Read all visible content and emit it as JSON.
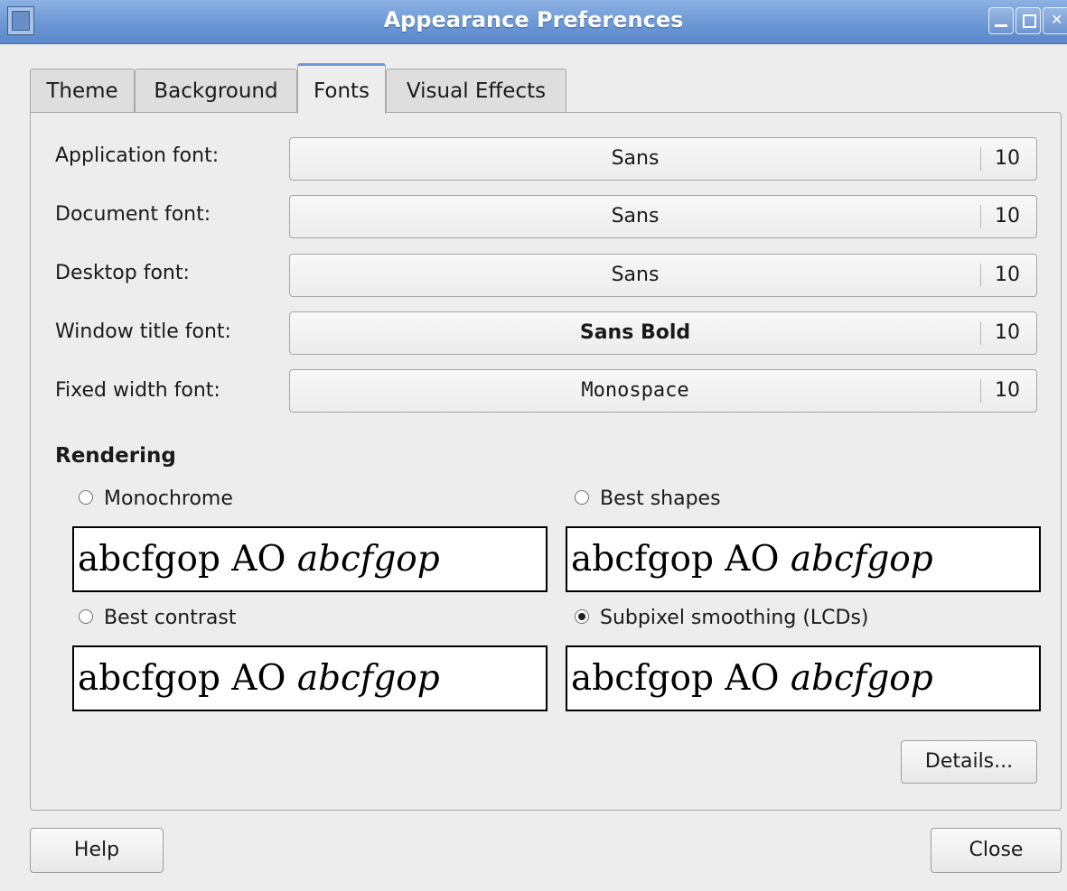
{
  "window": {
    "title": "Appearance Preferences"
  },
  "tabs": [
    {
      "label": "Theme",
      "active": false
    },
    {
      "label": "Background",
      "active": false
    },
    {
      "label": "Fonts",
      "active": true
    },
    {
      "label": "Visual Effects",
      "active": false
    }
  ],
  "fonts": [
    {
      "label": "Application font:",
      "font": "Sans",
      "size": "10"
    },
    {
      "label": "Document font:",
      "font": "Sans",
      "size": "10"
    },
    {
      "label": "Desktop font:",
      "font": "Sans",
      "size": "10"
    },
    {
      "label": "Window title font:",
      "font": "Sans Bold",
      "size": "10"
    },
    {
      "label": "Fixed width font:",
      "font": "Monospace",
      "size": "10"
    }
  ],
  "rendering": {
    "heading": "Rendering",
    "options": [
      {
        "label": "Monochrome",
        "checked": false,
        "sample_roman": "abcfgop AO ",
        "sample_italic": "abcfgop"
      },
      {
        "label": "Best shapes",
        "checked": false,
        "sample_roman": "abcfgop AO ",
        "sample_italic": "abcfgop"
      },
      {
        "label": "Best contrast",
        "checked": false,
        "sample_roman": "abcfgop AO ",
        "sample_italic": "abcfgop"
      },
      {
        "label": "Subpixel smoothing (LCDs)",
        "checked": true,
        "sample_roman": "abcfgop AO ",
        "sample_italic": "abcfgop"
      }
    ]
  },
  "buttons": {
    "details": "Details...",
    "help": "Help",
    "close": "Close"
  },
  "icons": [
    "window-menu-icon",
    "minimize-icon",
    "maximize-icon",
    "close-icon"
  ]
}
